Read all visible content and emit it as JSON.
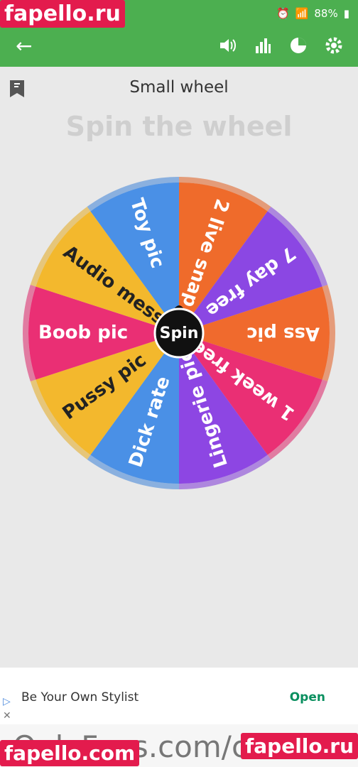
{
  "status": {
    "time": "",
    "battery": "88%"
  },
  "appbar": {
    "back_icon": "arrow-left-icon",
    "icons": [
      "volume-icon",
      "stats-bars-icon",
      "pie-chart-icon",
      "gear-icon"
    ]
  },
  "content": {
    "wheel_name": "Small wheel",
    "heading": "Spin the wheel",
    "spin_label": "Spin",
    "segments": [
      {
        "label": "2 live snap",
        "color": "#ef6b2b"
      },
      {
        "label": "7 day free",
        "color": "#8b47e3"
      },
      {
        "label": "Ass pic",
        "color": "#f06a2d"
      },
      {
        "label": "1 week free",
        "color": "#ea2f74"
      },
      {
        "label": "Lingerie pic",
        "color": "#8d46e3"
      },
      {
        "label": "Dick rate",
        "color": "#4a90e6"
      },
      {
        "label": "Pussy pic",
        "color": "#f3b82d"
      },
      {
        "label": "Boob pic",
        "color": "#ea2f74"
      },
      {
        "label": "Audio message",
        "color": "#f3b82d"
      },
      {
        "label": "Toy pic",
        "color": "#4a90e6"
      }
    ]
  },
  "ad": {
    "text": "Be Your Own Stylist",
    "button": "Open"
  },
  "footer": {
    "text": "OnlyFans.com/cassie"
  },
  "watermarks": {
    "top": "fapello.ru",
    "bottom_left": "fapello.com",
    "bottom_right": "fapello.ru"
  }
}
